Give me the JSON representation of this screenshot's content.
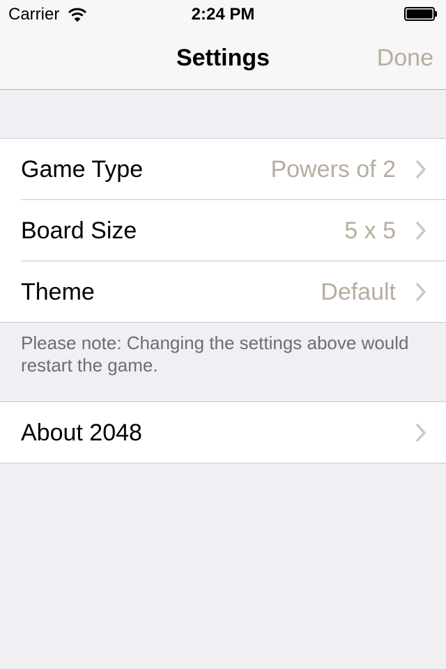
{
  "status_bar": {
    "carrier": "Carrier",
    "time": "2:24 PM"
  },
  "nav": {
    "title": "Settings",
    "done_label": "Done"
  },
  "settings": [
    {
      "label": "Game Type",
      "value": "Powers of 2"
    },
    {
      "label": "Board Size",
      "value": "5 x 5"
    },
    {
      "label": "Theme",
      "value": "Default"
    }
  ],
  "note": "Please note: Changing the settings above would restart the game.",
  "about": {
    "label": "About 2048"
  },
  "colors": {
    "accent": "#b7ad9f",
    "background": "#efeff4",
    "separator": "#c8c7cc",
    "footer_text": "#6d6d72"
  },
  "icons": [
    "wifi-icon",
    "battery-icon",
    "chevron-right-icon"
  ]
}
